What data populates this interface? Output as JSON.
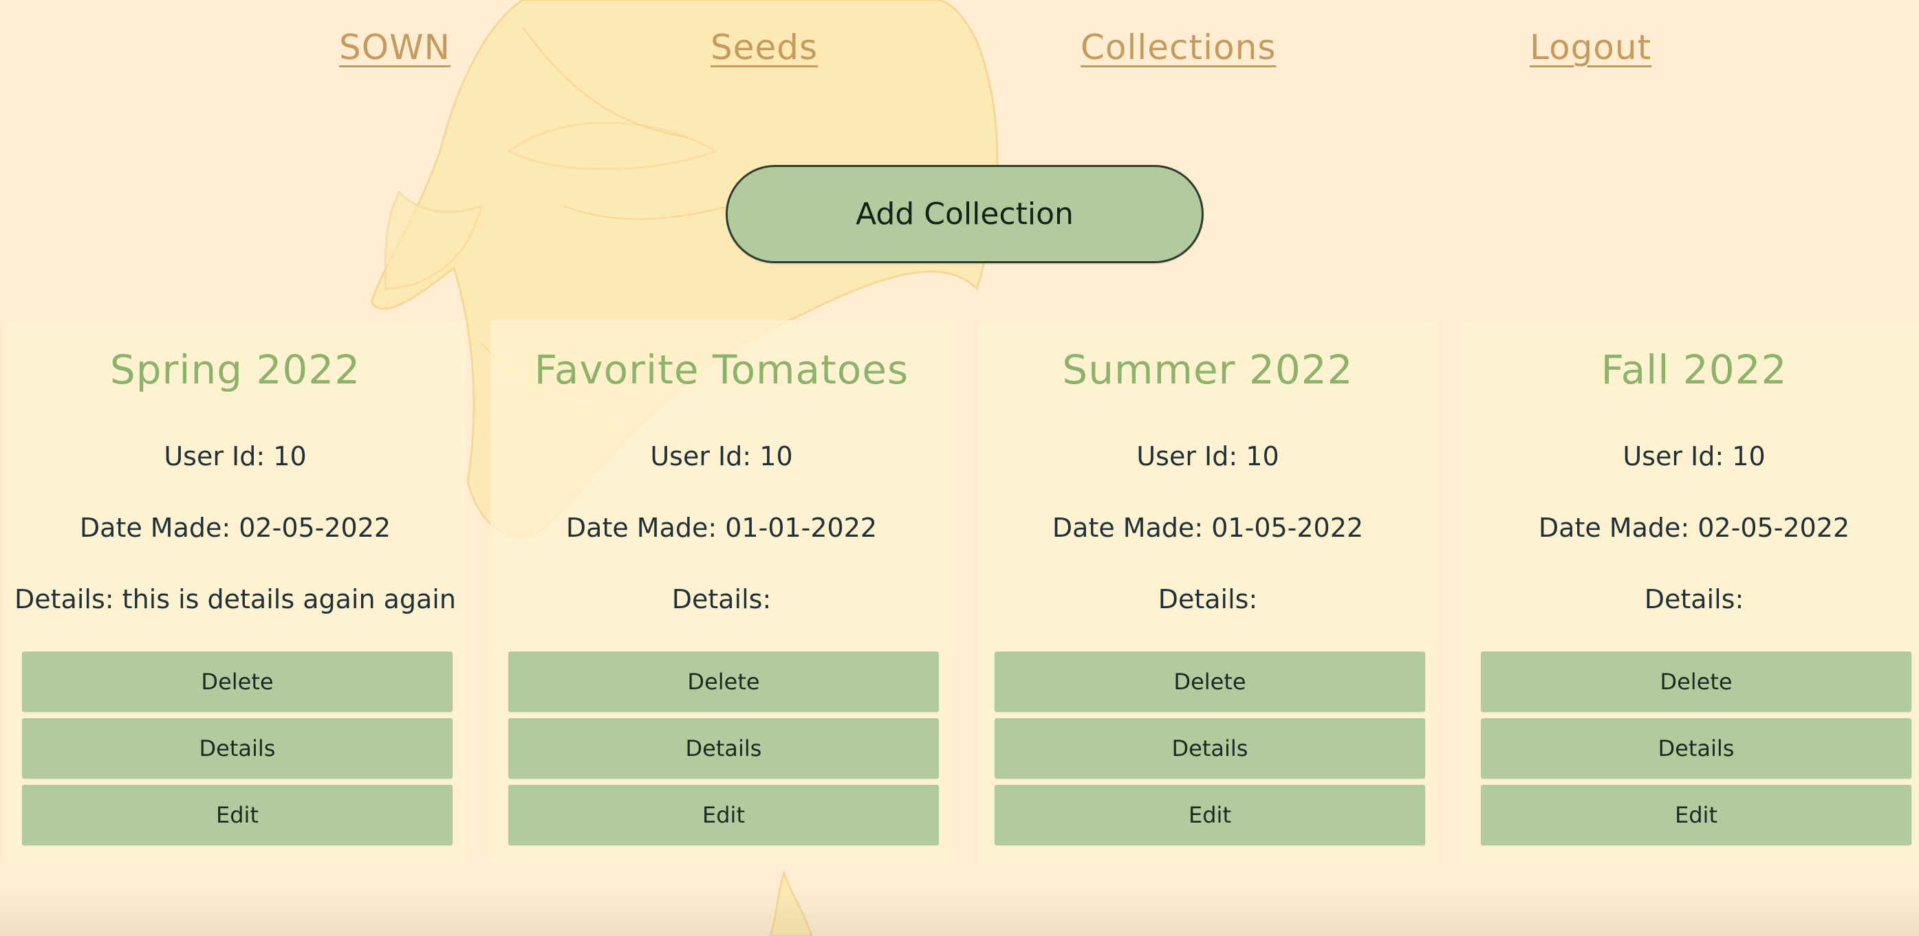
{
  "nav": {
    "brand": "SOWN",
    "seeds": "Seeds",
    "collections": "Collections",
    "logout": "Logout"
  },
  "add_button": "Add Collection",
  "cards": [
    {
      "title": "Spring 2022",
      "user_id": "User Id: 10",
      "date_made": "Date Made: 02-05-2022",
      "details": "Details: this is details again again",
      "delete_label": "Delete",
      "details_label": "Details",
      "edit_label": "Edit"
    },
    {
      "title": "Favorite Tomatoes",
      "user_id": "User Id: 10",
      "date_made": "Date Made: 01-01-2022",
      "details": "Details:",
      "delete_label": "Delete",
      "details_label": "Details",
      "edit_label": "Edit"
    },
    {
      "title": "Summer 2022",
      "user_id": "User Id: 10",
      "date_made": "Date Made: 01-05-2022",
      "details": "Details:",
      "delete_label": "Delete",
      "details_label": "Details",
      "edit_label": "Edit"
    },
    {
      "title": "Fall 2022",
      "user_id": "User Id: 10",
      "date_made": "Date Made: 02-05-2022",
      "details": "Details:",
      "delete_label": "Delete",
      "details_label": "Details",
      "edit_label": "Edit"
    }
  ],
  "colors": {
    "background": "#fcedd3",
    "nav_link": "#c59a5c",
    "card_title": "#8cb369",
    "button_green": "#b1cb9f",
    "text_dark": "#1f3038"
  }
}
